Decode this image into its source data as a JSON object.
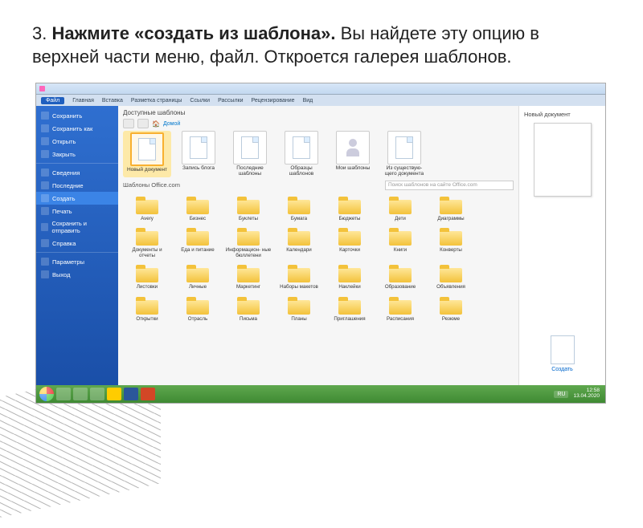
{
  "instruction": {
    "step": "3.",
    "bold": "Нажмите «создать из шаблона».",
    "rest": " Вы найдете эту опцию в верхней части меню, файл. Откроется галерея шаблонов."
  },
  "ribbon": {
    "active": "Файл",
    "tabs": [
      "Главная",
      "Вставка",
      "Разметка страницы",
      "Ссылки",
      "Рассылки",
      "Рецензирование",
      "Вид"
    ]
  },
  "sidebar": {
    "items": [
      {
        "label": "Сохранить"
      },
      {
        "label": "Сохранить как"
      },
      {
        "label": "Открыть"
      },
      {
        "label": "Закрыть"
      },
      {
        "label": "Сведения"
      },
      {
        "label": "Последние"
      },
      {
        "label": "Создать",
        "highlight": true
      },
      {
        "label": "Печать"
      },
      {
        "label": "Сохранить и отправить"
      },
      {
        "label": "Справка"
      },
      {
        "label": "Параметры"
      },
      {
        "label": "Выход"
      }
    ]
  },
  "gallery": {
    "title": "Доступные шаблоны",
    "home": "Домой",
    "templates": [
      {
        "label": "Новый документ",
        "selected": true,
        "icon": "doc"
      },
      {
        "label": "Запись блога",
        "icon": "doc"
      },
      {
        "label": "Последние шаблоны",
        "icon": "doc"
      },
      {
        "label": "Образцы шаблонов",
        "icon": "doc"
      },
      {
        "label": "Мои шаблоны",
        "icon": "person"
      },
      {
        "label": "Из существую-\nщего документа",
        "icon": "doc"
      }
    ],
    "office_title": "Шаблоны Office.com",
    "search_placeholder": "Поиск шаблонов на сайте Office.com",
    "folders": [
      "Avery",
      "Бизнес",
      "Буклеты",
      "Бумага",
      "Бюджеты",
      "Дети",
      "Диаграммы",
      "Документы и отчеты",
      "Еда и питание",
      "Информацион-\nные бюллетени",
      "Календари",
      "Карточки",
      "Книги",
      "Конверты",
      "Листовки",
      "Личные",
      "Маркетинг",
      "Наборы макетов",
      "Наклейки",
      "Образование",
      "Объявления",
      "Открытки",
      "Отрасль",
      "Письма",
      "Планы",
      "Приглашения",
      "Расписания",
      "Резюме"
    ]
  },
  "preview": {
    "title": "Новый документ",
    "create_label": "Создать"
  },
  "taskbar": {
    "lang": "RU",
    "time": "12:58",
    "date": "13.04.2020"
  }
}
